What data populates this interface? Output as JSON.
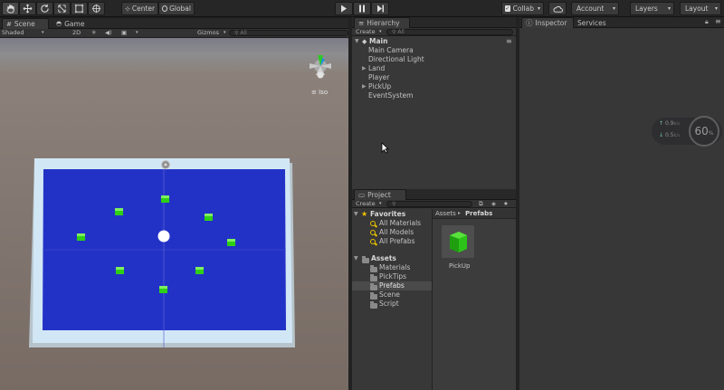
{
  "toolbar": {
    "pivot_label": "Center",
    "space_label": "Global",
    "collab_label": "Collab",
    "account_label": "Account",
    "layers_label": "Layers",
    "layout_label": "Layout"
  },
  "scene_panel": {
    "tabs": [
      "Scene",
      "Game"
    ],
    "shading_mode": "Shaded",
    "mode_2d": "2D",
    "gizmos_label": "Gizmos",
    "search_placeholder": "All",
    "projection_label": "Iso"
  },
  "hierarchy": {
    "tab_label": "Hierarchy",
    "create_label": "Create",
    "search_placeholder": "All",
    "scene_name": "Main",
    "items": [
      {
        "label": "Main Camera",
        "expandable": false
      },
      {
        "label": "Directional Light",
        "expandable": false
      },
      {
        "label": "Land",
        "expandable": true
      },
      {
        "label": "Player",
        "expandable": false
      },
      {
        "label": "PickUp",
        "expandable": true
      },
      {
        "label": "EventSystem",
        "expandable": false
      }
    ]
  },
  "project": {
    "tab_label": "Project",
    "create_label": "Create",
    "favorites_label": "Favorites",
    "favorites": [
      "All Materials",
      "All Models",
      "All Prefabs"
    ],
    "assets_label": "Assets",
    "folders": [
      "Materials",
      "PickTips",
      "Prefabs",
      "Scene",
      "Script"
    ],
    "selected_folder": "Prefabs",
    "breadcrumb": [
      "Assets",
      "Prefabs"
    ],
    "asset_items": [
      {
        "label": "PickUp"
      }
    ]
  },
  "inspector": {
    "tabs": [
      "Inspector",
      "Services"
    ],
    "stats": {
      "up_value": "0.9",
      "up_unit": "K/s",
      "down_value": "0.5",
      "down_unit": "K/s",
      "percent": "60",
      "percent_sign": "%"
    }
  },
  "colors": {
    "board_blue": "#2332c6",
    "board_border": "#cfe6f4",
    "pickup_green": "#2fcf17",
    "player_white": "#ffffff",
    "editor_dark": "#3a3a3a",
    "favorites_star": "#f5c400"
  },
  "icons": {
    "hand": "hand-tool-icon",
    "move": "move-tool-icon",
    "rotate": "rotate-tool-icon",
    "scale": "scale-tool-icon",
    "rect": "rect-tool-icon",
    "transform": "transform-tool-icon",
    "play": "play-icon",
    "pause": "pause-icon",
    "step": "step-icon",
    "cloud": "cloud-icon",
    "lock": "lock-icon",
    "menu": "menu-icon"
  }
}
